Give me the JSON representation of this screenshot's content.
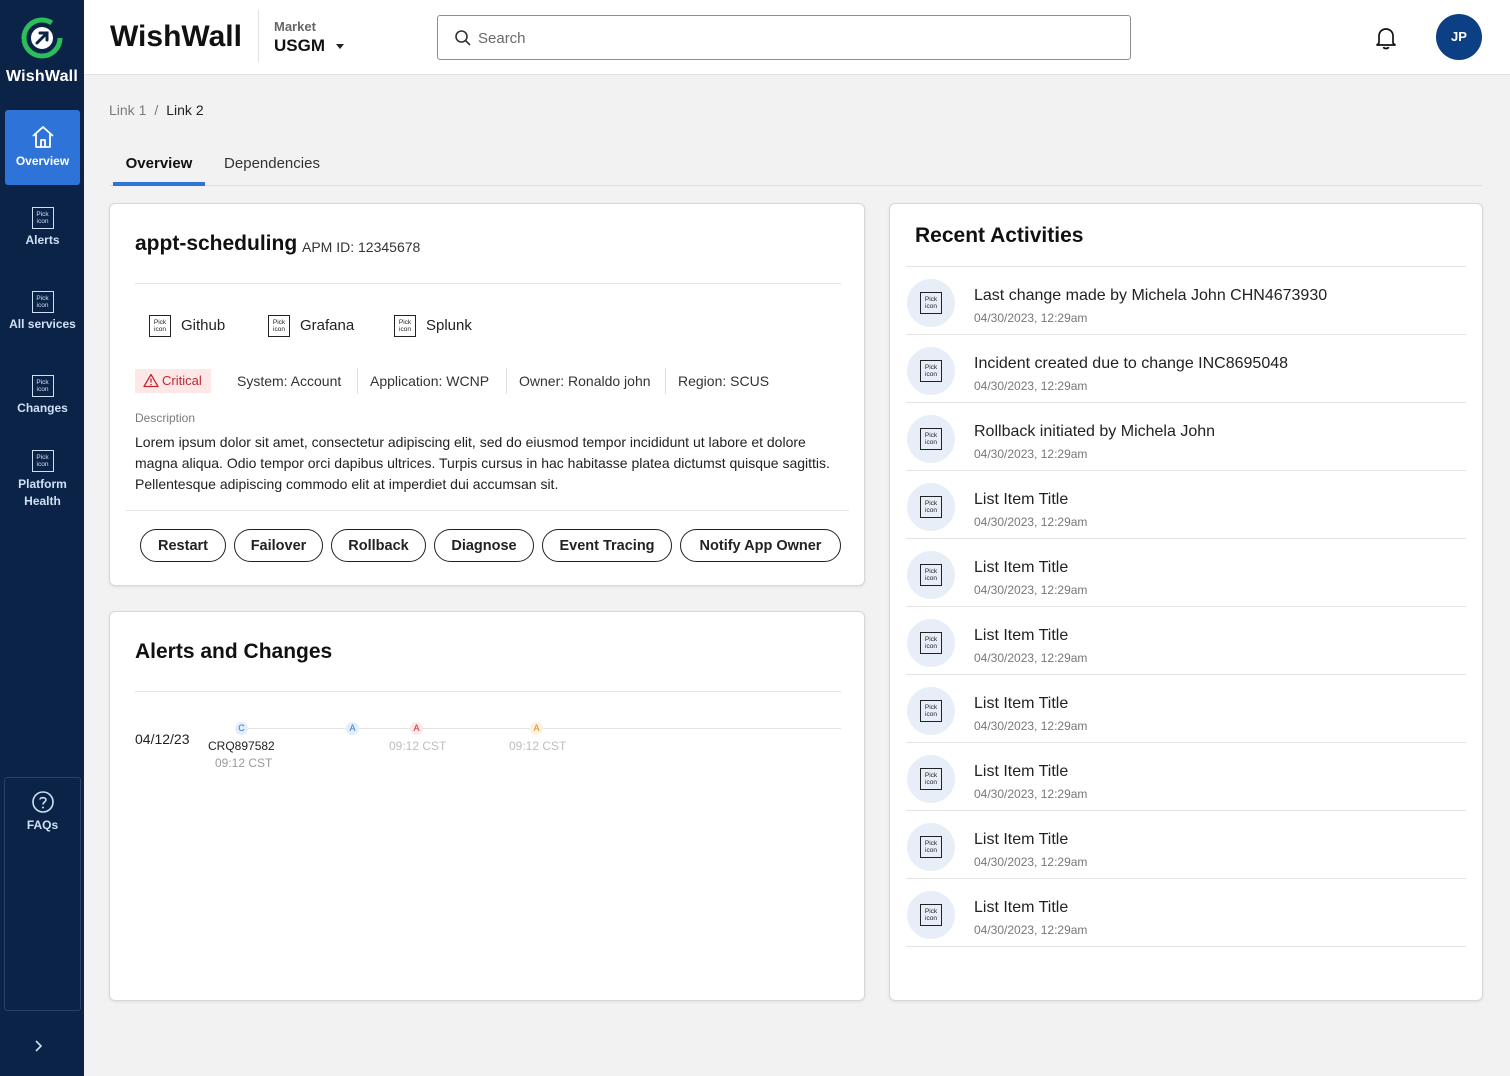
{
  "app": {
    "name": "WishWall"
  },
  "nav": {
    "overview": "Overview",
    "alerts": "Alerts",
    "services": "All services",
    "changes": "Changes",
    "platform_line1": "Platform",
    "platform_line2": "Health",
    "faqs": "FAQs",
    "icon_line1": "Pick",
    "icon_line2": "icon"
  },
  "header": {
    "market_label": "Market",
    "market_value": "USGM",
    "search_placeholder": "Search",
    "avatar": "JP"
  },
  "breadcrumb": {
    "link1": "Link 1",
    "sep": "/",
    "link2": "Link 2"
  },
  "tabs": {
    "overview": "Overview",
    "dependencies": "Dependencies"
  },
  "summary": {
    "name": "appt-scheduling",
    "apm": "APM ID: 12345678",
    "tools": [
      "Github",
      "Grafana",
      "Splunk"
    ],
    "severity": "Critical",
    "system": "System: Account",
    "application": "Application: WCNP",
    "owner": "Owner: Ronaldo john",
    "region": "Region: SCUS",
    "desc_label": "Description",
    "description": "Lorem ipsum dolor sit amet, consectetur adipiscing elit, sed do eiusmod tempor incididunt ut labore et dolore magna aliqua. Odio tempor orci dapibus ultrices. Turpis cursus in hac habitasse platea dictumst quisque sagittis. Pellentesque adipiscing commodo elit at imperdiet dui accumsan sit.",
    "actions": [
      "Restart",
      "Failover",
      "Rollback",
      "Diagnose",
      "Event Tracing",
      "Notify App Owner"
    ]
  },
  "alerts": {
    "title": "Alerts and Changes",
    "date": "04/12/23",
    "events": [
      {
        "letter": "C",
        "id": "CRQ897582",
        "time": "09:12 CST"
      },
      {
        "letter": "A"
      },
      {
        "letter": "A",
        "time": "09:12 CST"
      },
      {
        "letter": "A",
        "time": "09:12 CST"
      }
    ]
  },
  "activities": {
    "title": "Recent Activities",
    "items": [
      {
        "title": "Last change made by Michela John CHN4673930",
        "time": "04/30/2023, 12:29am"
      },
      {
        "title": "Incident created due to change INC8695048",
        "time": "04/30/2023, 12:29am"
      },
      {
        "title": "Rollback initiated by Michela John",
        "time": "04/30/2023, 12:29am"
      },
      {
        "title": "List Item Title",
        "time": "04/30/2023, 12:29am"
      },
      {
        "title": "List Item Title",
        "time": "04/30/2023, 12:29am"
      },
      {
        "title": "List Item Title",
        "time": "04/30/2023, 12:29am"
      },
      {
        "title": "List Item Title",
        "time": "04/30/2023, 12:29am"
      },
      {
        "title": "List Item Title",
        "time": "04/30/2023, 12:29am"
      },
      {
        "title": "List Item Title",
        "time": "04/30/2023, 12:29am"
      },
      {
        "title": "List Item Title",
        "time": "04/30/2023, 12:29am"
      }
    ]
  },
  "colors": {
    "sidebar": "#0b2347",
    "accent": "#2e74d8",
    "critical": "#c0282d",
    "avatar": "#0d3f85"
  }
}
